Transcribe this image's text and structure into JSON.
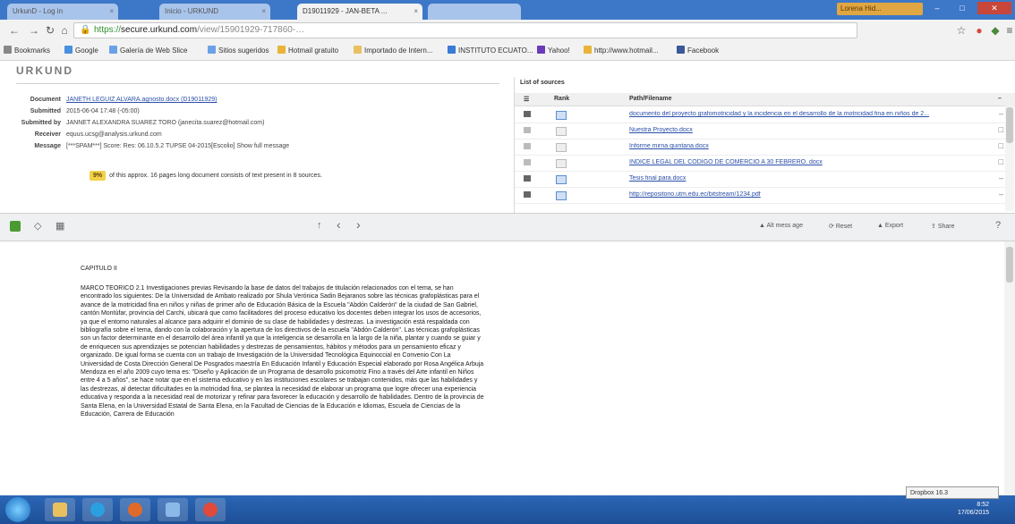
{
  "browser": {
    "tabs": [
      {
        "label": "UrkunD - Log in"
      },
      {
        "label": "Inicio - URKUND"
      },
      {
        "label": "D19011929 - JAN-BETA ..."
      }
    ],
    "url_https": "https://",
    "url_domain": "secure.urkund.com",
    "url_rest": "/view/15901929-717860-…",
    "window_user": "Lorena Hid...",
    "bookmarks": [
      {
        "label": "Bookmarks",
        "color": "#888888"
      },
      {
        "label": "Google",
        "color": "#4a8fe0"
      },
      {
        "label": "Galería de Web Slice",
        "color": "#6aa1e8"
      },
      {
        "label": "Sitios sugeridos",
        "color": "#6aa1e8"
      },
      {
        "label": "Hotmail gratuito",
        "color": "#e8b43a"
      },
      {
        "label": "Importado de Intern...",
        "color": "#e8c060"
      },
      {
        "label": "INSTITUTO ECUATO...",
        "color": "#3a7bd5"
      },
      {
        "label": "Yahoo!",
        "color": "#6a3ab8"
      },
      {
        "label": "http://www.hotmail...",
        "color": "#e8b43a"
      },
      {
        "label": "Facebook",
        "color": "#3b5998"
      }
    ]
  },
  "urkund": {
    "logo": "URKUND",
    "details": [
      {
        "label": "Document",
        "value": "JANETH LEGUIZ ALVARA.agnosto.docx (D19011929)",
        "link": true
      },
      {
        "label": "Submitted",
        "value": "2015-06-04 17:48 (-05:00)",
        "link": false
      },
      {
        "label": "Submitted by",
        "value": "JANNET ALEXANDRA SUAREZ TORO (janecita.suarez@hotmail.com)",
        "link": false
      },
      {
        "label": "Receiver",
        "value": "equus.ucsg@analysis.urkund.com",
        "link": false
      },
      {
        "label": "Message",
        "value": "[***SPAM***] Score: Res: 06.10.5.2 TUPSE 04-2015[Escolio] Show full message",
        "link": false
      }
    ],
    "summary_pct": "9%",
    "summary_text": "of this approx. 16 pages long document consists of text present in 8 sources."
  },
  "sources": {
    "title": "List of sources",
    "col_rank": "Rank",
    "col_path": "Path/Filename",
    "rows": [
      {
        "path": "documento del proyecto grafomotricidad y la incidencia en el desarrollo de la motricidad fina en niños de 2...",
        "active": true
      },
      {
        "path": "Nuestra Proyecto.docx",
        "active": false
      },
      {
        "path": "Informe mirna quintana.docx",
        "active": false
      },
      {
        "path": "INDICE LEGAL DEL CODIGO DE COMERCIO A 30 FEBRERO. docx",
        "active": false
      },
      {
        "path": "Tesis final para.docx",
        "active": true
      },
      {
        "path": "http://repositorio.utm.edu.ec/bitstream/1234.pdf",
        "active": true
      }
    ]
  },
  "toolbar": {
    "prev": "‹",
    "next": "›",
    "actions": [
      "Alt mess age",
      "Reset",
      "Export",
      "Share"
    ]
  },
  "document": {
    "heading": "CAPITULO II",
    "body": "MARCO TEORICO 2.1 Investigaciones previas Revisando la base de datos del trabajos de titulación relacionados con el tema, se han encontrado los siguientes: De la Universidad de Ambato realizado por Shula Verónica Sadin Bejaranos sobre las técnicas grafoplásticas para el avance de la motricidad fina en niños y niñas de primer año de Educación Básica de la Escuela \"Abdón Calderón\" de la ciudad de San Gabriel, cantón Montúfar, provincia del Carchi, ubicará que como facilitadores del proceso educativo los docentes deben integrar los usos de accesorios, ya que el entorno naturales al alcance para adquirir el dominio de su clase de habilidades y destrezas. La investigación está respaldada con bibliografía sobre el tema, dando con la colaboración y la apertura de los directivos de la escuela \"Abdón Calderón\". Las técnicas grafoplásticas son un factor determinante en el desarrollo del área infantil ya que la inteligencia se desarrolla en la largo de la niña, plantar y cuando se guiar y de enriquecen sus aprendizajes se potencian habilidades y destrezas de pensamientos, hábitos y métodos para un pensamiento eficaz y organizado. De igual forma se cuenta con un trabajo de Investigación de la Universidad Tecnológica Equinoccial en Convenio Con La Universidad de Costa Dirección General De Posgrados maestría En Educación Infantil y Educación Especial elaborado por Rosa Angélica Arbuja Mendoza en el año 2009 cuyo tema es: \"Diseño y Aplicación de un Programa de desarrollo psicomotriz Fino a través del Arte infantil en Niños entre 4 a 5 años\", se hace notar que en el sistema educativo y en las instituciones escolares se trabajan contenidos, más que las habilidades y las destrezas, al detectar dificultades en la motricidad fina, se plantea la necesidad de elaborar un programa que logre ofrecer una experiencia educativa y responda a la necesidad real de motorizar y refinar para favorecer la educación y desarrollo de habilidades. Dentro de la provincia de Santa Elena, en la Universidad Estatal de Santa Elena, en la Facultad de Ciencias de la Educación e Idiomas, Escuela de Ciencias de la Educación, Carrera de Educación"
  },
  "taskbar": {
    "popup": "Dropbox 16.3",
    "time": "8:52",
    "date": "17/06/2015"
  }
}
